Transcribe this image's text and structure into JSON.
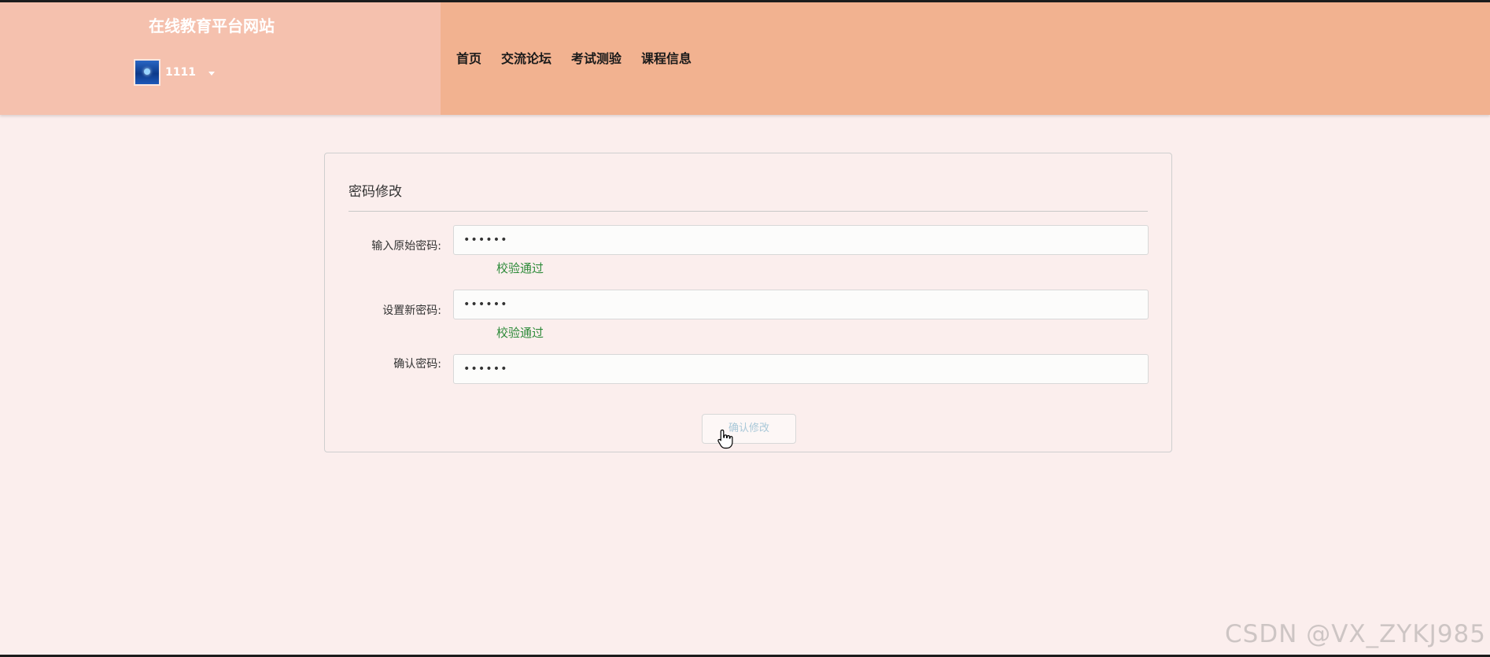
{
  "header": {
    "site_title": "在线教育平台网站",
    "user": {
      "name": "1111",
      "avatar_icon": "avatar-image",
      "dropdown_icon": "caret-down-icon"
    },
    "nav": [
      {
        "label": "首页"
      },
      {
        "label": "交流论坛"
      },
      {
        "label": "考试测验"
      },
      {
        "label": "课程信息"
      }
    ]
  },
  "form": {
    "title": "密码修改",
    "fields": [
      {
        "label": "输入原始密码:",
        "value": "••••••",
        "hint": "校验通过"
      },
      {
        "label": "设置新密码:",
        "value": "••••••",
        "hint": "校验通过"
      },
      {
        "label": "确认密码:",
        "value": "••••••",
        "hint": ""
      }
    ],
    "submit_label": "确认修改"
  },
  "watermark": "CSDN @VX_ZYKJ985",
  "colors": {
    "header_bg": "#f2b290",
    "brand_panel_bg": "#f5c1ae",
    "page_bg": "#fbeeed",
    "hint_green": "#2e8b3a"
  }
}
